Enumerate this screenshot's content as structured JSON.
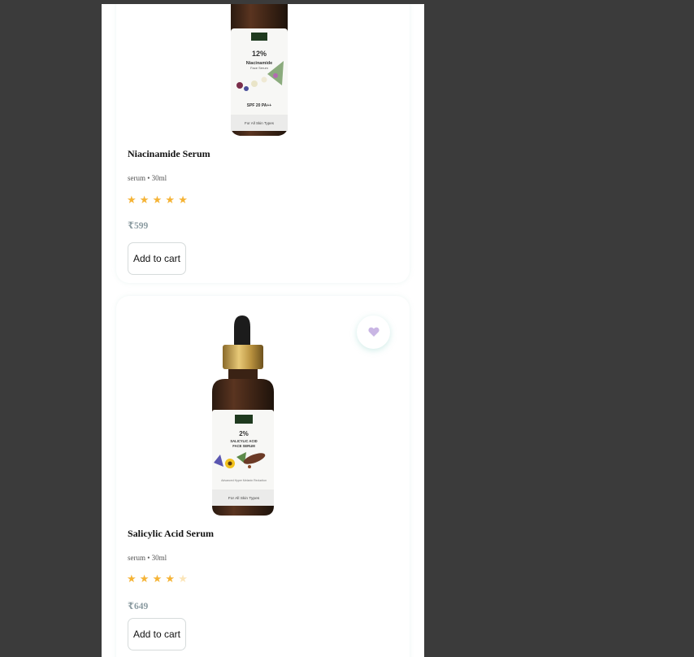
{
  "products": [
    {
      "name": "Niacinamide Serum",
      "meta": "serum • 30ml",
      "rating": 5,
      "rating_max": 5,
      "price": "₹599",
      "add_label": "Add to cart",
      "bottle_label": {
        "strength": "12%",
        "line1": "Niacinamide",
        "line2": "Face Serum",
        "spf": "SPF 20   PA++",
        "footer": "For All Skin Types"
      }
    },
    {
      "name": "Salicylic Acid Serum",
      "meta": "serum • 30ml",
      "rating": 4,
      "rating_max": 5,
      "price": "₹649",
      "add_label": "Add to cart",
      "bottle_label": {
        "strength": "2%",
        "line1": "SALICYLIC ACID",
        "line2": "FACE SERUM",
        "tagline": "Advanced Hyper Melanin Reduction",
        "footer": "For All Skin Types"
      }
    }
  ],
  "colors": {
    "backdrop": "#3b3b3b",
    "star_on": "#f5b335",
    "star_off": "#fbe5b8",
    "price": "#8a9aa0",
    "heart": "#c9b6e4"
  },
  "icons": {
    "wishlist": "heart-icon",
    "rating": "star-icon"
  }
}
